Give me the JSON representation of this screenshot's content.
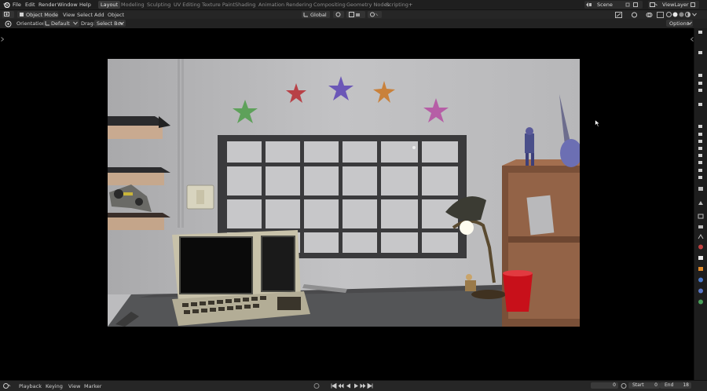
{
  "menu": {
    "file": "File",
    "edit": "Edit",
    "render": "Render",
    "window": "Window",
    "help": "Help"
  },
  "workspaces": [
    "Layout",
    "Modeling",
    "Sculpting",
    "UV Editing",
    "Texture Paint",
    "Shading",
    "Animation",
    "Rendering",
    "Compositing",
    "Geometry Nodes",
    "Scripting"
  ],
  "active_workspace": "Layout",
  "scene": {
    "name": "Scene",
    "view_layer": "ViewLayer"
  },
  "header": {
    "mode": "Object Mode",
    "view": "View",
    "select": "Select",
    "add": "Add",
    "object": "Object",
    "transform_orientation": "Global"
  },
  "tool_header": {
    "orientation_label": "Orientation:",
    "orientation_value": "Default",
    "drag_label": "Drag:",
    "drag_value": "Select Box",
    "options": "Options"
  },
  "timeline": {
    "playback": "Playback",
    "keying": "Keying",
    "view": "View",
    "marker": "Marker",
    "current_frame": "0",
    "start_label": "Start",
    "start": "0",
    "end_label": "End",
    "end": "18"
  },
  "colors": {
    "accent_active": "#4772b3",
    "bg_dark": "#1f1f1f",
    "viewport_bg": "#000000"
  }
}
